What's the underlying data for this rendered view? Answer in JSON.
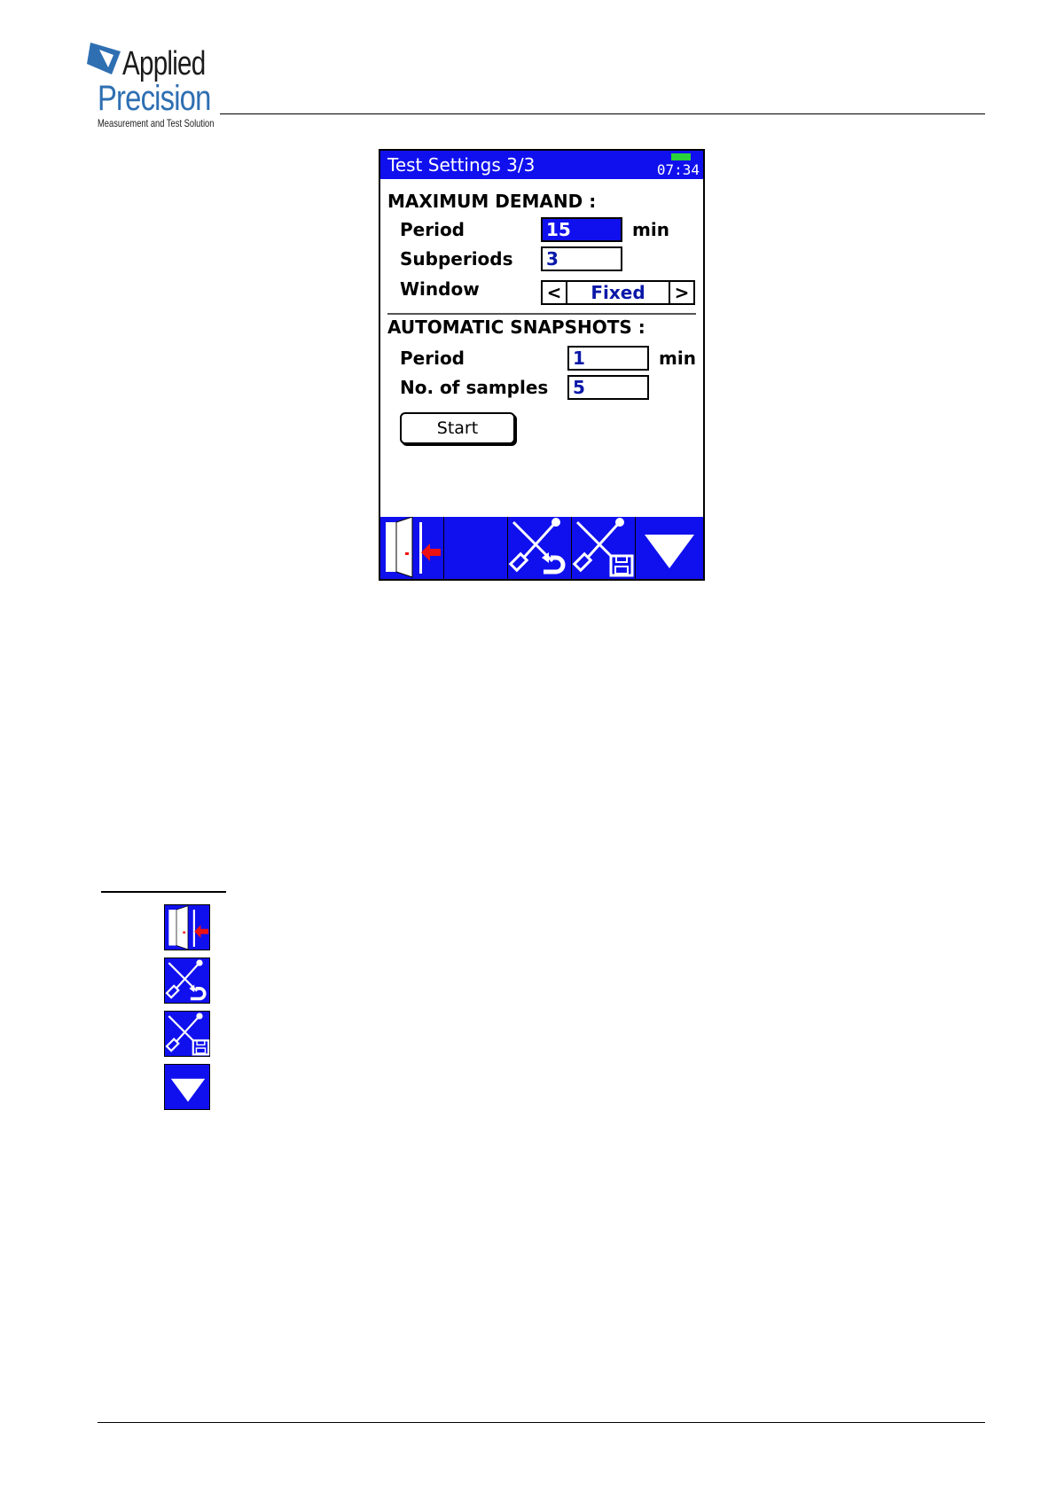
{
  "logo": {
    "line1": "Applied",
    "line2": "Precision",
    "tagline": "Measurement and Test Solution"
  },
  "screen": {
    "title": "Test Settings 3/3",
    "clock": "07:34",
    "max_demand": {
      "heading": "MAXIMUM DEMAND :",
      "period_label": "Period",
      "period_value": "15",
      "period_unit": "min",
      "subperiods_label": "Subperiods",
      "subperiods_value": "3",
      "window_label": "Window",
      "window_value": "Fixed",
      "prev_symbol": "<",
      "next_symbol": ">"
    },
    "snapshots": {
      "heading": "AUTOMATIC SNAPSHOTS :",
      "period_label": "Period",
      "period_value": "1",
      "period_unit": "min",
      "samples_label": "No. of samples",
      "samples_value": "5"
    },
    "start_label": "Start",
    "toolbar_icons": [
      "exit-door-icon",
      "empty-slot",
      "tools-undo-icon",
      "tools-save-icon",
      "triangle-down-icon"
    ]
  },
  "colors": {
    "screen_blue": "#1010ee",
    "value_blue": "#0a18a8",
    "battery_green": "#29d13a",
    "exit_arrow_red": "#ee1111",
    "logo_blue": "#2e6fb2"
  },
  "legend_icons": [
    "exit-door-icon",
    "tools-undo-icon",
    "tools-save-icon",
    "triangle-down-icon"
  ]
}
